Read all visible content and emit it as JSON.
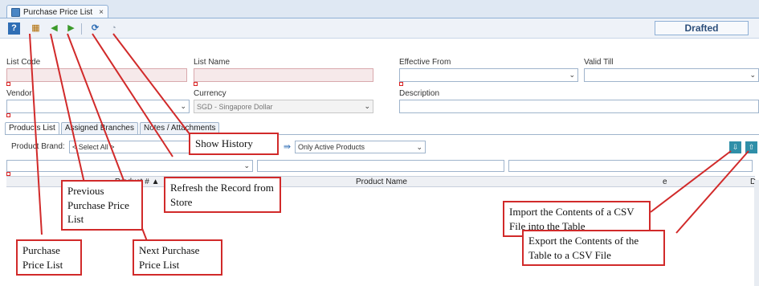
{
  "window": {
    "tab_title": "Purchase Price List",
    "tab_close": "×"
  },
  "toolbar": {
    "help_icon": "help-icon",
    "list_icon": "list-icon",
    "prev_icon": "previous-arrow-icon",
    "next_icon": "next-arrow-icon",
    "refresh_icon": "refresh-icon",
    "history_icon": "history-icon",
    "help_glyph": "?",
    "list_glyph": "▦",
    "prev_glyph": "◀",
    "next_glyph": "▶",
    "refresh_glyph": "⟳",
    "history_glyph": "◔"
  },
  "status": "Drafted",
  "form": {
    "list_code_label": "List Code",
    "list_code_value": "",
    "list_name_label": "List Name",
    "list_name_value": "",
    "effective_from_label": "Effective From",
    "effective_from_value": "",
    "valid_till_label": "Valid Till",
    "valid_till_value": "",
    "vendor_label": "Vendor",
    "vendor_value": "",
    "currency_label": "Currency",
    "currency_value": "SGD - Singapore Dollar",
    "description_label": "Description",
    "description_value": ""
  },
  "subtabs": [
    {
      "label": "Products List"
    },
    {
      "label": "Assigned Branches"
    },
    {
      "label": "Notes / Attachments"
    }
  ],
  "products": {
    "brand_label": "Product Brand:",
    "brand_value": "< Select All >",
    "filter_value": "Only Active Products",
    "columns": [
      "Product # ▲",
      "Product Name"
    ],
    "col_partial_right": "e",
    "col_partial_far": "D"
  },
  "callouts": {
    "show_history": "Show History",
    "refresh": "Refresh the Record from Store",
    "previous": "Previous Purchase Price List",
    "next": "Next Purchase Price List",
    "purchase": "Purchase Price List",
    "import": "Import the Contents of a CSV File into the Table",
    "export": "Export the Contents of the Table to a CSV File"
  },
  "colors": {
    "accent": "#4a86c5",
    "callout_border": "#d12a2a",
    "status_text": "#2c4e7a"
  }
}
